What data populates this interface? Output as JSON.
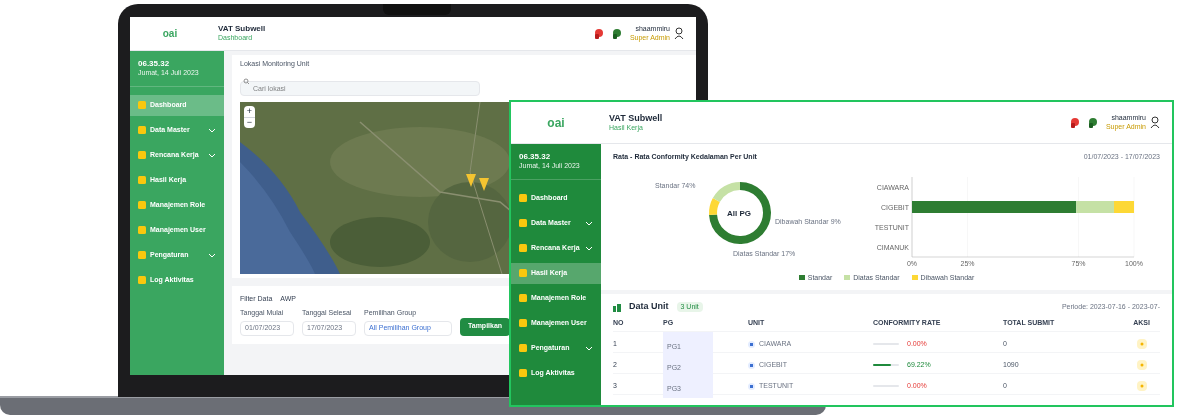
{
  "laptop": {
    "header": {
      "logo": "oai",
      "title": "VAT Subwell",
      "subtitle": "Dashboard",
      "user": "shaammiru",
      "role": "Super Admin"
    },
    "clock": {
      "time": "06.35.32",
      "date": "Jumat, 14 Juli 2023"
    },
    "sidebar": [
      {
        "label": "Dashboard",
        "expandable": false,
        "selected": true
      },
      {
        "label": "Data Master",
        "expandable": true,
        "selected": false
      },
      {
        "label": "Rencana Kerja",
        "expandable": true,
        "selected": false
      },
      {
        "label": "Hasil Kerja",
        "expandable": false,
        "selected": false
      },
      {
        "label": "Manajemen Role",
        "expandable": false,
        "selected": false
      },
      {
        "label": "Manajemen User",
        "expandable": false,
        "selected": false
      },
      {
        "label": "Pengaturan",
        "expandable": true,
        "selected": false
      },
      {
        "label": "Log Aktivitas",
        "expandable": false,
        "selected": false
      }
    ],
    "map_title": "Lokasi Monitoring Unit",
    "search": {
      "placeholder": "Cari lokasi"
    },
    "map": {
      "zoom_in": "+",
      "zoom_out": "−"
    },
    "filter": {
      "title": "Filter Data",
      "badge": "AWP",
      "fields": [
        {
          "label": "Tanggal Mulai",
          "value": "01/07/2023"
        },
        {
          "label": "Tanggal Selesai",
          "value": "17/07/2023"
        }
      ],
      "group_label": "Pemilihan Group",
      "group_tag": "All Pemilihan Group",
      "button": "Tampilkan"
    }
  },
  "window": {
    "header": {
      "logo": "oai",
      "title": "VAT Subwell",
      "subtitle": "Hasil Kerja",
      "user": "shaammiru",
      "role": "Super Admin"
    },
    "clock": {
      "time": "06.35.32",
      "date": "Jumat, 14 Juli 2023"
    },
    "sidebar": [
      {
        "label": "Dashboard",
        "expandable": false,
        "selected": false
      },
      {
        "label": "Data Master",
        "expandable": true,
        "selected": false
      },
      {
        "label": "Rencana Kerja",
        "expandable": true,
        "selected": false
      },
      {
        "label": "Hasil Kerja",
        "expandable": false,
        "selected": true
      },
      {
        "label": "Manajemen Role",
        "expandable": false,
        "selected": false
      },
      {
        "label": "Manajemen User",
        "expandable": false,
        "selected": false
      },
      {
        "label": "Pengaturan",
        "expandable": true,
        "selected": false
      },
      {
        "label": "Log Aktivitas",
        "expandable": false,
        "selected": false
      }
    ],
    "panel_title": "Rata - Rata Conformity Kedalaman Per Unit",
    "date_range": "01/07/2023 - 17/07/2023",
    "donut": {
      "center": "All PG",
      "labels": [
        "Standar 74%",
        "Dibawah Standar 9%",
        "Diatas Standar 17%"
      ]
    },
    "chart_data": {
      "type": "bar",
      "orientation": "horizontal",
      "stacked": true,
      "categories": [
        "CIAWARA",
        "CIGEBIT",
        "TESTUNIT",
        "CIMANUK"
      ],
      "series": [
        {
          "name": "Standar",
          "color": "#2e7d32",
          "values": [
            0,
            74,
            0,
            0
          ]
        },
        {
          "name": "Diatas Standar",
          "color": "#c5e1a5",
          "values": [
            0,
            17,
            0,
            0
          ]
        },
        {
          "name": "Dibawah Standar",
          "color": "#fdd835",
          "values": [
            0,
            9,
            0,
            0
          ]
        }
      ],
      "xlim": [
        0,
        100
      ],
      "xticks": [
        {
          "value": 0,
          "label": "0%"
        },
        {
          "value": 25,
          "label": "25%"
        },
        {
          "value": 75,
          "label": "75%"
        },
        {
          "value": 100,
          "label": "100%"
        }
      ]
    },
    "table": {
      "title": "Data Unit",
      "badge": "3 Unit",
      "period": "Periode: 2023-07-16 - 2023-07-",
      "columns": [
        "NO",
        "PG",
        "UNIT",
        "CONFORMITY RATE",
        "TOTAL SUBMIT",
        "AKSI"
      ],
      "rows": [
        {
          "no": "1",
          "pg": "PG1",
          "unit": "CIAWARA",
          "rate": "0.00%",
          "level": 0,
          "total": "0"
        },
        {
          "no": "2",
          "pg": "PG2",
          "unit": "CIGEBIT",
          "rate": "69.22%",
          "level": 0.69,
          "total": "1090"
        },
        {
          "no": "3",
          "pg": "PG3",
          "unit": "TESTUNIT",
          "rate": "0.00%",
          "level": 0,
          "total": "0"
        }
      ]
    }
  }
}
